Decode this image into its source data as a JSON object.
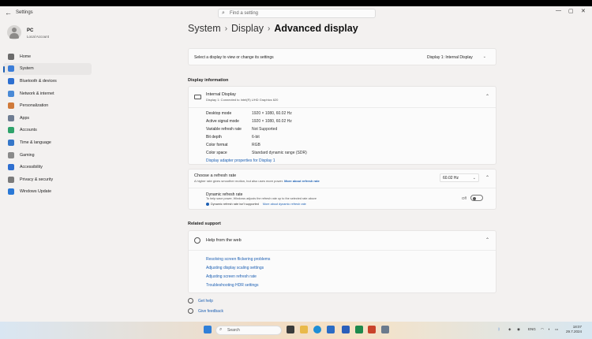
{
  "app": {
    "title": "Settings",
    "back_icon": "back-arrow-icon"
  },
  "search": {
    "placeholder": "Find a setting"
  },
  "window_controls": {
    "minimize": "—",
    "maximize": "▢",
    "close": "✕"
  },
  "profile": {
    "name": "PC",
    "account": "Local Account"
  },
  "nav": {
    "items": [
      {
        "label": "Home",
        "icon": "home-icon",
        "color": "#6b6b6b"
      },
      {
        "label": "System",
        "icon": "system-icon",
        "color": "#3b7dd8",
        "active": true
      },
      {
        "label": "Bluetooth & devices",
        "icon": "bluetooth-icon",
        "color": "#2d6fd0"
      },
      {
        "label": "Network & internet",
        "icon": "network-icon",
        "color": "#4a8ad6"
      },
      {
        "label": "Personalization",
        "icon": "brush-icon",
        "color": "#d07a3a"
      },
      {
        "label": "Apps",
        "icon": "apps-icon",
        "color": "#6f7d92"
      },
      {
        "label": "Accounts",
        "icon": "accounts-icon",
        "color": "#2fa36b"
      },
      {
        "label": "Time & language",
        "icon": "clock-globe-icon",
        "color": "#3677c9"
      },
      {
        "label": "Gaming",
        "icon": "gamepad-icon",
        "color": "#8a8a8a"
      },
      {
        "label": "Accessibility",
        "icon": "accessibility-icon",
        "color": "#2f6fd0"
      },
      {
        "label": "Privacy & security",
        "icon": "shield-icon",
        "color": "#7b7b7b"
      },
      {
        "label": "Windows Update",
        "icon": "update-icon",
        "color": "#2a78d6"
      }
    ]
  },
  "breadcrumb": {
    "level1": "System",
    "level2": "Display",
    "current": "Advanced display",
    "sep": "›"
  },
  "display_select": {
    "label": "Select a display to view or change its settings",
    "value": "Display 1: Internal Display",
    "chevron": "⌄"
  },
  "display_info": {
    "section_label": "Display information",
    "title": "Internal Display",
    "subtitle": "Display 1: Connected to Intel(R) UHD Graphics 620",
    "chevron": "⌃",
    "properties": [
      {
        "key": "Desktop mode",
        "value": "1920 × 1080, 60.02 Hz"
      },
      {
        "key": "Active signal mode",
        "value": "1920 × 1080, 60.02 Hz"
      },
      {
        "key": "Variable refresh rate",
        "value": "Not Supported"
      },
      {
        "key": "Bit depth",
        "value": "6-bit"
      },
      {
        "key": "Color format",
        "value": "RGB"
      },
      {
        "key": "Color space",
        "value": "Standard dynamic range (SDR)"
      }
    ],
    "adapter_link": "Display adapter properties for Display 1"
  },
  "refresh_rate": {
    "title": "Choose a refresh rate",
    "subtitle": "A higher rate gives smoother motion, but also uses more power.",
    "more_link": "More about refresh rate",
    "value": "60.02 Hz",
    "chevron": "⌄",
    "collapse_chevron": "⌃",
    "dynamic_title": "Dynamic refresh rate",
    "dynamic_sub": "To help save power, Windows adjusts the refresh rate up to the selected rate above",
    "dynamic_info": "Dynamic refresh rate isn't supported",
    "dynamic_link": "More about dynamic refresh rate",
    "toggle_label": "Off",
    "toggle_on": false
  },
  "related_support": {
    "section_label": "Related support",
    "title": "Help from the web",
    "chevron": "⌃",
    "links": [
      "Resolving screen flickering problems",
      "Adjusting display scaling settings",
      "Adjusting screen refresh rate",
      "Troubleshooting HDR settings"
    ]
  },
  "footer": {
    "get_help": "Get help",
    "give_feedback": "Give feedback"
  },
  "taskbar": {
    "search_placeholder": "Search",
    "language": "ENG",
    "time": "18:07",
    "date": "29.7.2024"
  }
}
